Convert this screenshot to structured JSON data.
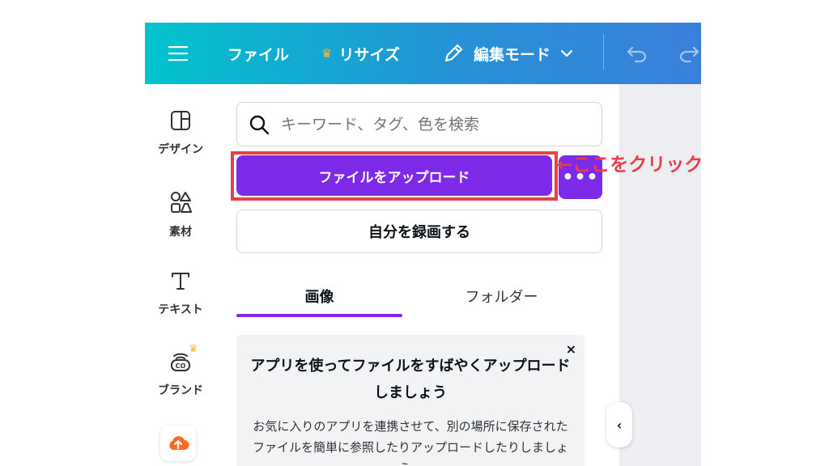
{
  "topbar": {
    "file_label": "ファイル",
    "resize_label": "リサイズ",
    "edit_mode_label": "編集モード"
  },
  "sidebar": {
    "items": [
      {
        "label": "デザイン"
      },
      {
        "label": "素材"
      },
      {
        "label": "テキスト"
      },
      {
        "label": "ブランド"
      }
    ]
  },
  "panel": {
    "search_placeholder": "キーワード、タグ、色を検索",
    "upload_label": "ファイルをアップロード",
    "more_label": "•••",
    "record_label": "自分を録画する",
    "tabs": [
      {
        "label": "画像"
      },
      {
        "label": "フォルダー"
      }
    ],
    "promo": {
      "close": "×",
      "title": "アプリを使ってファイルをすばやくアップロードしましょう",
      "body": "お気に入りのアプリを連携させて、別の場所に保存されたファイルを簡単に参照したりアップロードしたりしましょう。"
    },
    "collapse_label": "‹"
  },
  "annotation": {
    "text": "←ここをクリック"
  },
  "colors": {
    "accent": "#7d2ae8",
    "highlight": "#e8404a",
    "topbar_start": "#00c4cc",
    "topbar_end": "#3a7fdc",
    "crown": "#f5b93d"
  }
}
